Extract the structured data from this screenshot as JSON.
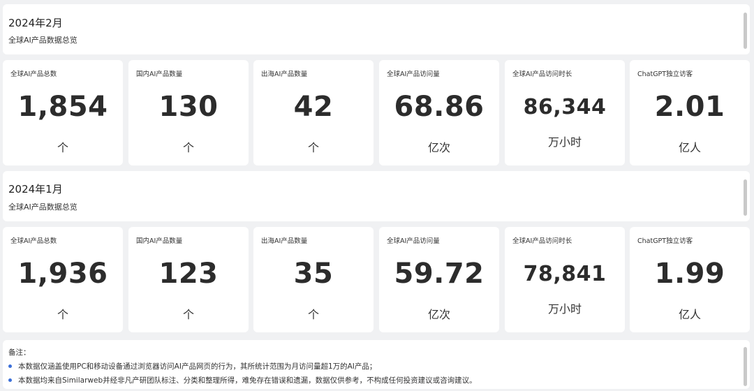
{
  "sections": [
    {
      "title": "2024年2月",
      "subtitle": "全球AI产品数据总览",
      "cards": [
        {
          "label": "全球AI产品总数",
          "value": "1,854",
          "unit": "个"
        },
        {
          "label": "国内AI产品数量",
          "value": "130",
          "unit": "个"
        },
        {
          "label": "出海AI产品数量",
          "value": "42",
          "unit": "个"
        },
        {
          "label": "全球AI产品访问量",
          "value": "68.86",
          "unit": "亿次"
        },
        {
          "label": "全球AI产品访问时长",
          "value": "86,344",
          "unit": "万小时"
        },
        {
          "label": "ChatGPT独立访客",
          "value": "2.01",
          "unit": "亿人"
        }
      ]
    },
    {
      "title": "2024年1月",
      "subtitle": "全球AI产品数据总览",
      "cards": [
        {
          "label": "全球AI产品总数",
          "value": "1,936",
          "unit": "个"
        },
        {
          "label": "国内AI产品数量",
          "value": "123",
          "unit": "个"
        },
        {
          "label": "出海AI产品数量",
          "value": "35",
          "unit": "个"
        },
        {
          "label": "全球AI产品访问量",
          "value": "59.72",
          "unit": "亿次"
        },
        {
          "label": "全球AI产品访问时长",
          "value": "78,841",
          "unit": "万小时"
        },
        {
          "label": "ChatGPT独立访客",
          "value": "1.99",
          "unit": "亿人"
        }
      ]
    }
  ],
  "notes": {
    "heading": "备注：",
    "items": [
      "本数据仅涵盖使用PC和移动设备通过浏览器访问AI产品网页的行为，其所统计范围为月访问量超1万的AI产品；",
      "本数据均来自Similarweb并经非凡产研团队标注、分类和整理所得，难免存在错误和遗漏，数据仅供参考，不构成任何投资建议或咨询建议。"
    ]
  },
  "colors": {
    "background": "#f0f1f3",
    "panel": "#ffffff",
    "bullet": "#3b6fd8",
    "value_text": "#2c2c2c"
  }
}
